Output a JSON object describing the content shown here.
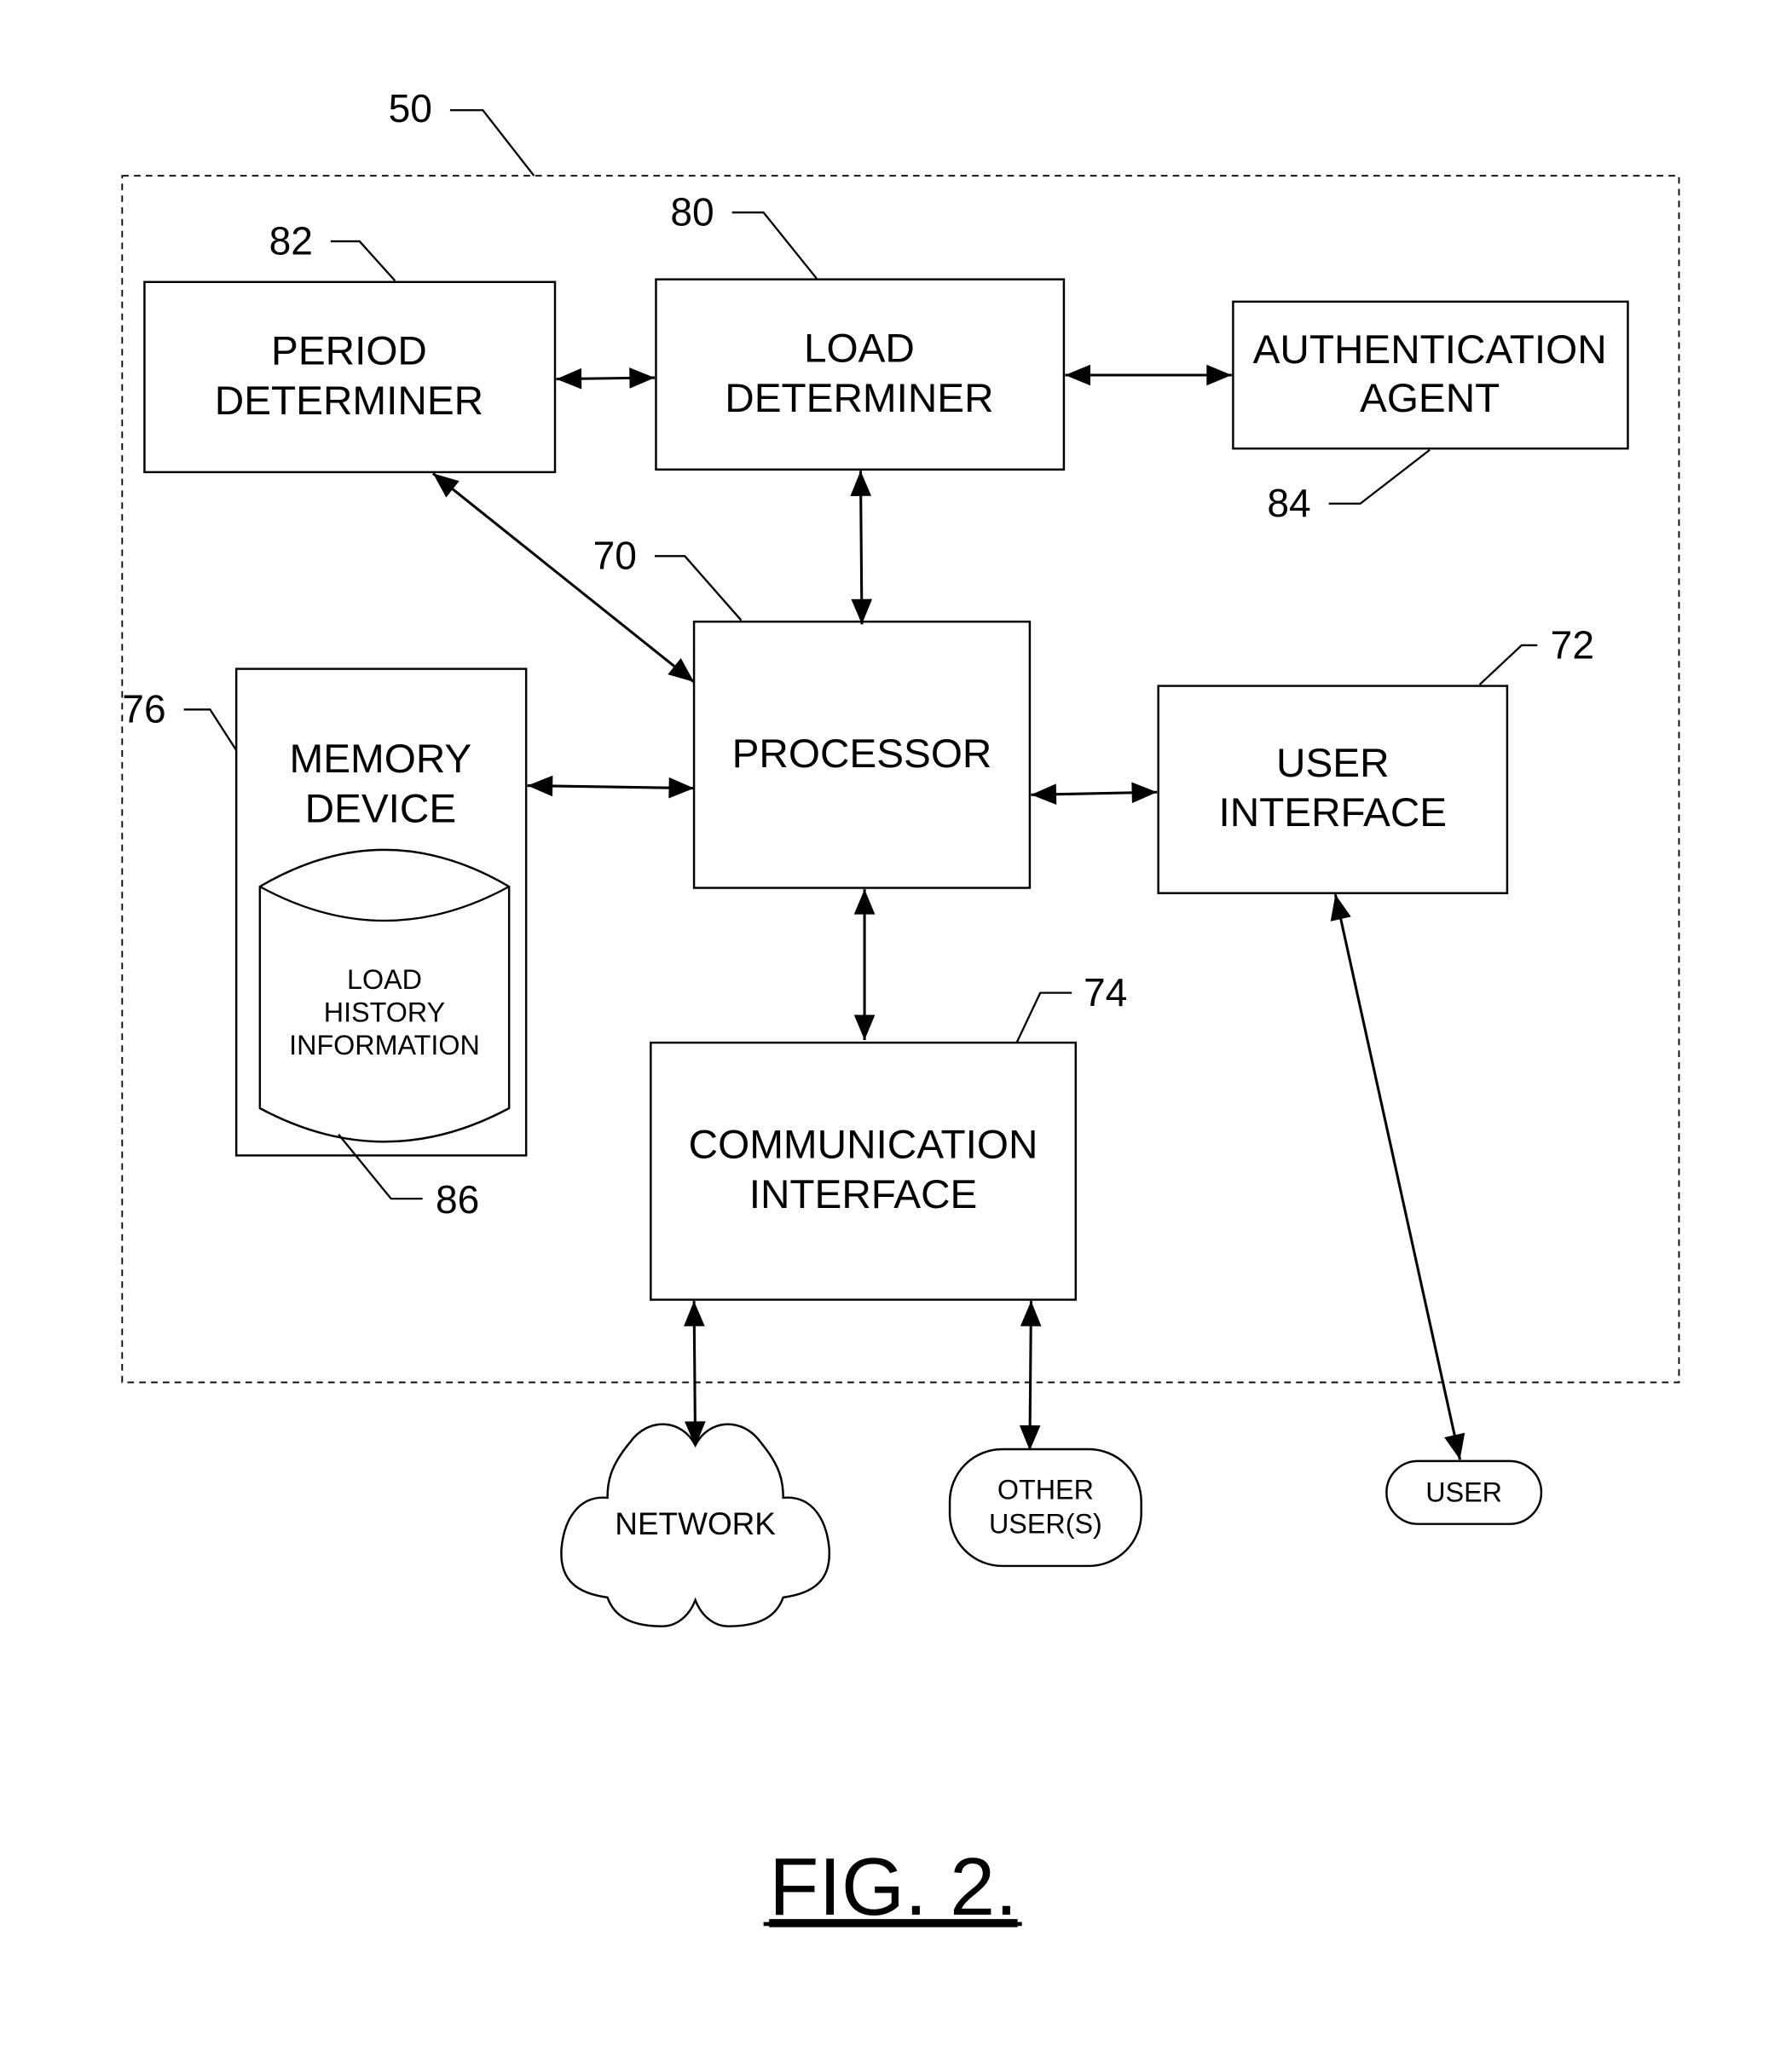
{
  "figure": {
    "caption": "FIG. 2.",
    "container_ref": "50"
  },
  "blocks": {
    "period_determiner": {
      "ref": "82",
      "lines": [
        "PERIOD",
        "DETERMINER"
      ]
    },
    "load_determiner": {
      "ref": "80",
      "lines": [
        "LOAD",
        "DETERMINER"
      ]
    },
    "authentication_agent": {
      "ref": "84",
      "lines": [
        "AUTHENTICATION",
        "AGENT"
      ]
    },
    "processor": {
      "ref": "70",
      "lines": [
        "PROCESSOR"
      ]
    },
    "memory_device": {
      "ref": "76",
      "lines": [
        "MEMORY",
        "DEVICE"
      ]
    },
    "load_history": {
      "ref": "86",
      "lines": [
        "LOAD",
        "HISTORY",
        "INFORMATION"
      ]
    },
    "user_interface": {
      "ref": "72",
      "lines": [
        "USER",
        "INTERFACE"
      ]
    },
    "communication_interface": {
      "ref": "74",
      "lines": [
        "COMMUNICATION",
        "INTERFACE"
      ]
    }
  },
  "externals": {
    "network": {
      "lines": [
        "NETWORK"
      ]
    },
    "other_users": {
      "lines": [
        "OTHER",
        "USER(S)"
      ]
    },
    "user": {
      "lines": [
        "USER"
      ]
    }
  },
  "connections": [
    {
      "from": "PERIOD DETERMINER",
      "to": "LOAD DETERMINER",
      "type": "bidirectional"
    },
    {
      "from": "LOAD DETERMINER",
      "to": "AUTHENTICATION AGENT",
      "type": "bidirectional"
    },
    {
      "from": "PERIOD DETERMINER",
      "to": "PROCESSOR",
      "type": "bidirectional"
    },
    {
      "from": "LOAD DETERMINER",
      "to": "PROCESSOR",
      "type": "bidirectional"
    },
    {
      "from": "MEMORY DEVICE",
      "to": "PROCESSOR",
      "type": "bidirectional"
    },
    {
      "from": "PROCESSOR",
      "to": "USER INTERFACE",
      "type": "bidirectional"
    },
    {
      "from": "PROCESSOR",
      "to": "COMMUNICATION INTERFACE",
      "type": "bidirectional"
    },
    {
      "from": "COMMUNICATION INTERFACE",
      "to": "NETWORK",
      "type": "bidirectional"
    },
    {
      "from": "COMMUNICATION INTERFACE",
      "to": "OTHER USER(S)",
      "type": "bidirectional"
    },
    {
      "from": "USER INTERFACE",
      "to": "USER",
      "type": "bidirectional"
    }
  ]
}
